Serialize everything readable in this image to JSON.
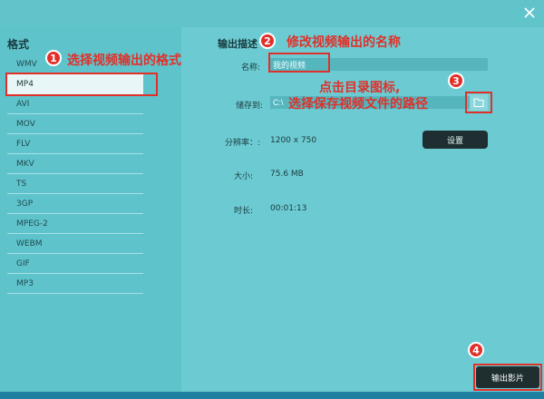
{
  "window": {
    "close_icon": "close-icon"
  },
  "sidebar": {
    "header": "格式",
    "items": [
      "WMV",
      "MP4",
      "AVI",
      "MOV",
      "FLV",
      "MKV",
      "TS",
      "3GP",
      "MPEG-2",
      "WEBM",
      "GIF",
      "MP3"
    ],
    "selected": "MP4"
  },
  "main": {
    "section_title": "输出描述",
    "name_label": "名称:",
    "name_value": "我的视频",
    "save_label": "储存到:",
    "save_path": "C:\\",
    "resolution_label": "分辨率：:",
    "resolution_value": "1200 x 750",
    "settings_button": "设置",
    "size_label": "大小:",
    "size_value": "75.6 MB",
    "duration_label": "时长:",
    "duration_value": "00:01:13",
    "export_button": "输出影片",
    "folder_icon": "folder-icon"
  },
  "annotations": {
    "n1": "1",
    "t1": "选择视频输出的格式",
    "n2": "2",
    "t2": "修改视频输出的名称",
    "n3": "3",
    "t3a": "点击目录图标,",
    "t3b": "选择保存视频文件的路径",
    "n4": "4"
  },
  "colors": {
    "accent": "#e0302a",
    "background": "#6ccbd2",
    "dark_button": "#1f2f31"
  }
}
